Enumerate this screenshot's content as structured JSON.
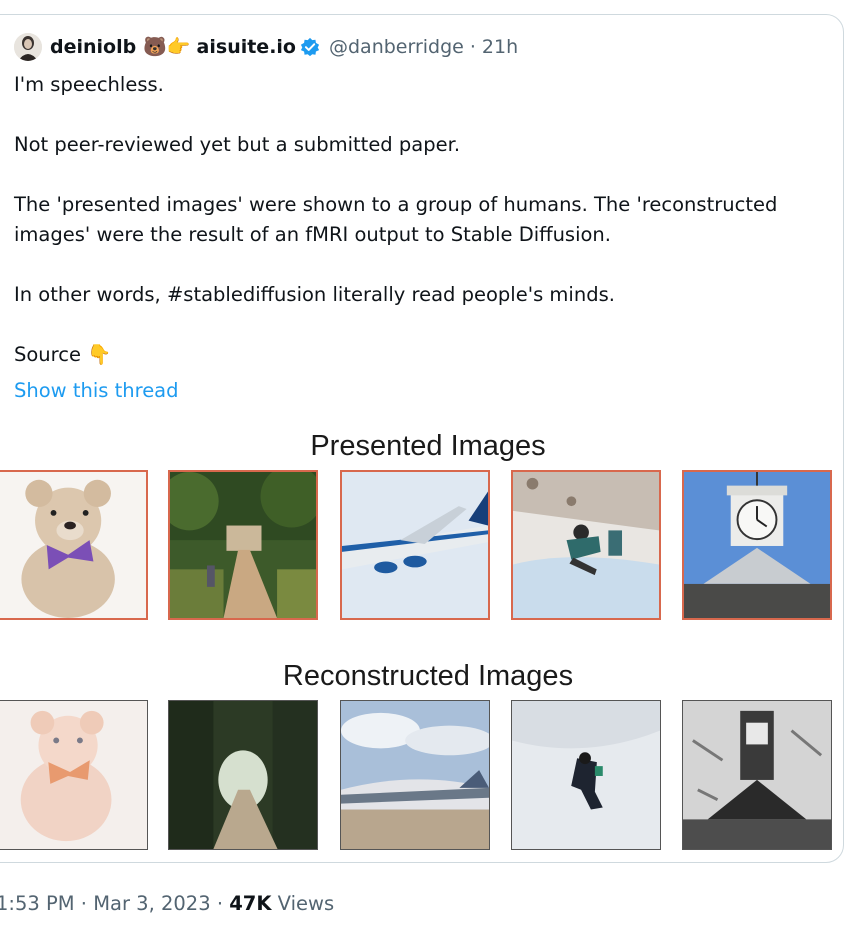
{
  "tweet": {
    "author_name": "deiniolb",
    "author_emojis": "🐻👉",
    "author_link": "aisuite.io",
    "handle": "@danberridge",
    "separator": "·",
    "age": "21h",
    "lines": [
      "I'm speechless.",
      "Not peer-reviewed yet but a submitted paper.",
      "The 'presented images' were shown to a group of humans. The 'reconstructed",
      "images' were the result of an fMRI output to Stable Diffusion.",
      "In other words, #stablediffusion literally read people's minds.",
      "Source 👇"
    ],
    "show_thread": "Show this thread"
  },
  "figure": {
    "presented_title": "Presented Images",
    "reconstructed_title": "Reconstructed Images",
    "presented": [
      "teddy bear",
      "garden path",
      "airplane",
      "snowboarder",
      "clock tower"
    ],
    "reconstructed": [
      "teddy bear",
      "tree-lined path",
      "airplane",
      "skier",
      "tower"
    ],
    "frame_color_presented": "#d8684d",
    "frame_color_reconstructed": "#555555"
  },
  "footer": {
    "time": "1:53 PM",
    "date": "Mar 3, 2023",
    "views_count": "47K",
    "views_label": "Views"
  },
  "colors": {
    "link": "#1d9bf0",
    "secondary_text": "#536471",
    "verified": "#1d9bf0"
  }
}
